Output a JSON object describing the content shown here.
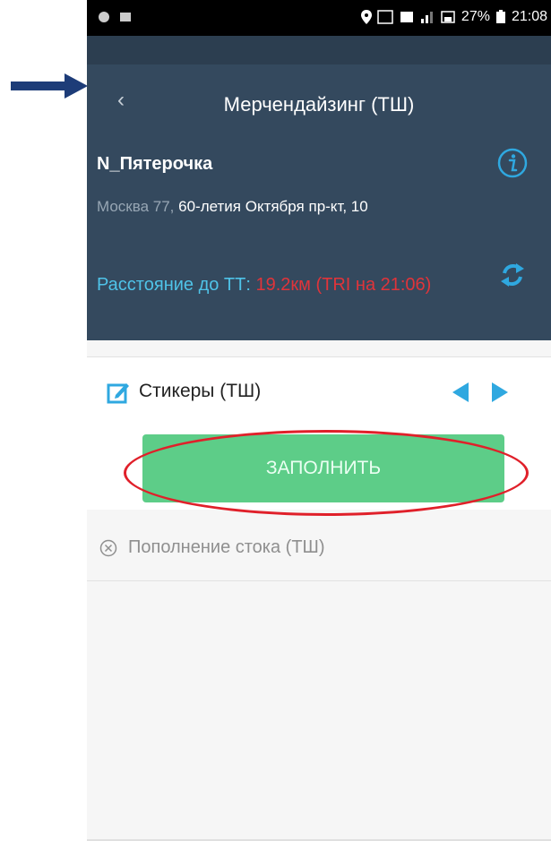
{
  "status_bar": {
    "battery": "27%",
    "time": "21:08"
  },
  "header": {
    "title": "Мерчендайзинг (ТШ)",
    "store_name": "N_Пятерочка",
    "address_region": "Москва 77, ",
    "address_street": "60-летия Октября пр-кт, 10",
    "distance_label": "Расстояние до ТТ: ",
    "distance_value": "19.2км (TRI на 21:06)"
  },
  "task_row": {
    "label": "Стикеры (ТШ)"
  },
  "fill_button": {
    "label": "ЗАПОЛНИТЬ"
  },
  "task_row_2": {
    "label": "Пополнение стока (ТШ)"
  },
  "colors": {
    "header_bg": "#34495e",
    "accent_blue": "#2fa8e0",
    "button_green": "#5dcd88",
    "distance_red": "#e0343a",
    "annotation_red": "#e0202a",
    "annotation_arrow": "#1d3c78"
  },
  "icons": [
    "arrow-annotation-icon",
    "back-icon",
    "info-icon",
    "refresh-icon",
    "edit-icon",
    "nav-left-icon",
    "nav-right-icon",
    "close-circle-icon"
  ]
}
